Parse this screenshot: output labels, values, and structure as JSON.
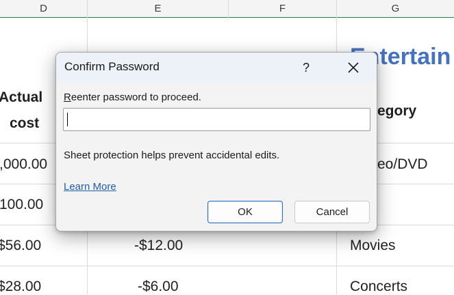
{
  "sheet": {
    "columns": [
      "D",
      "E",
      "F",
      "G"
    ],
    "title_partial": "Entertain",
    "header_actual": "Actual",
    "header_cost": "cost",
    "header_category": "egory",
    "rows": [
      {
        "d": ",000.00",
        "e": "",
        "g": "eo/DVD"
      },
      {
        "d": "100.00",
        "e": "",
        "g": ""
      },
      {
        "d": "$56.00",
        "e": "-$12.00",
        "g": "Movies"
      },
      {
        "d": "$28.00",
        "e": "-$6.00",
        "g": "Concerts"
      }
    ]
  },
  "dialog": {
    "title": "Confirm Password",
    "help_label": "?",
    "prompt_first_letter": "R",
    "prompt_rest": "eenter password to proceed.",
    "password_value": "",
    "info_text": "Sheet protection helps prevent accidental edits.",
    "learn_more_label": "Learn More",
    "ok_label": "OK",
    "cancel_label": "Cancel"
  },
  "colors": {
    "title_blue": "#4472c4",
    "link_blue": "#1e5fa8",
    "selection_green": "#1e7e45",
    "ok_border": "#2c6fbf"
  },
  "icons": {
    "close": "close-icon"
  }
}
